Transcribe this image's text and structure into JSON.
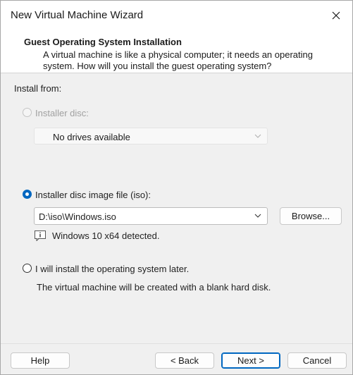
{
  "window": {
    "title": "New Virtual Machine Wizard"
  },
  "header": {
    "title": "Guest Operating System Installation",
    "description": "A virtual machine is like a physical computer; it needs an operating system. How will you install the guest operating system?"
  },
  "install_from": {
    "label": "Install from:",
    "options": [
      {
        "label": "Installer disc:",
        "selected": false,
        "enabled": false
      },
      {
        "label": "Installer disc image file (iso):",
        "selected": true,
        "enabled": true
      },
      {
        "label": "I will install the operating system later.",
        "selected": false,
        "enabled": true
      }
    ],
    "disc_combo_value": "No drives available",
    "iso_combo_value": "D:\\iso\\Windows.iso",
    "browse_label": "Browse...",
    "detected_text": "Windows 10 x64 detected.",
    "later_note": "The virtual machine will be created with a blank hard disk."
  },
  "footer": {
    "help_label": "Help",
    "back_label": "< Back",
    "next_label": "Next >",
    "cancel_label": "Cancel"
  },
  "colors": {
    "accent": "#0067c0",
    "disabled_text": "#a0a0a0"
  },
  "icons": {
    "close": "close-icon",
    "chevron": "chevron-down-icon",
    "info": "info-icon"
  }
}
